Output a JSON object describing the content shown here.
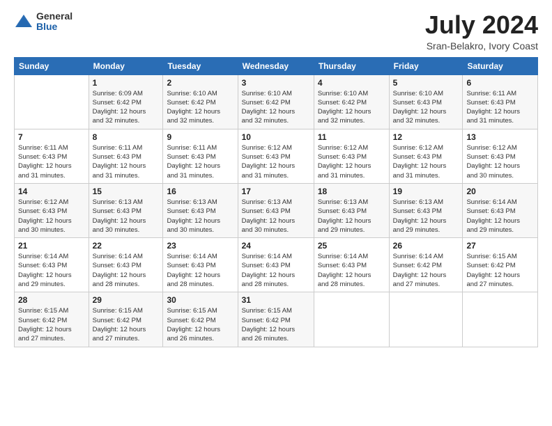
{
  "logo": {
    "general": "General",
    "blue": "Blue"
  },
  "title": {
    "month_year": "July 2024",
    "location": "Sran-Belakro, Ivory Coast"
  },
  "weekdays": [
    "Sunday",
    "Monday",
    "Tuesday",
    "Wednesday",
    "Thursday",
    "Friday",
    "Saturday"
  ],
  "weeks": [
    [
      {
        "day": "",
        "info": ""
      },
      {
        "day": "1",
        "info": "Sunrise: 6:09 AM\nSunset: 6:42 PM\nDaylight: 12 hours\nand 32 minutes."
      },
      {
        "day": "2",
        "info": "Sunrise: 6:10 AM\nSunset: 6:42 PM\nDaylight: 12 hours\nand 32 minutes."
      },
      {
        "day": "3",
        "info": "Sunrise: 6:10 AM\nSunset: 6:42 PM\nDaylight: 12 hours\nand 32 minutes."
      },
      {
        "day": "4",
        "info": "Sunrise: 6:10 AM\nSunset: 6:42 PM\nDaylight: 12 hours\nand 32 minutes."
      },
      {
        "day": "5",
        "info": "Sunrise: 6:10 AM\nSunset: 6:43 PM\nDaylight: 12 hours\nand 32 minutes."
      },
      {
        "day": "6",
        "info": "Sunrise: 6:11 AM\nSunset: 6:43 PM\nDaylight: 12 hours\nand 31 minutes."
      }
    ],
    [
      {
        "day": "7",
        "info": "Sunrise: 6:11 AM\nSunset: 6:43 PM\nDaylight: 12 hours\nand 31 minutes."
      },
      {
        "day": "8",
        "info": "Sunrise: 6:11 AM\nSunset: 6:43 PM\nDaylight: 12 hours\nand 31 minutes."
      },
      {
        "day": "9",
        "info": "Sunrise: 6:11 AM\nSunset: 6:43 PM\nDaylight: 12 hours\nand 31 minutes."
      },
      {
        "day": "10",
        "info": "Sunrise: 6:12 AM\nSunset: 6:43 PM\nDaylight: 12 hours\nand 31 minutes."
      },
      {
        "day": "11",
        "info": "Sunrise: 6:12 AM\nSunset: 6:43 PM\nDaylight: 12 hours\nand 31 minutes."
      },
      {
        "day": "12",
        "info": "Sunrise: 6:12 AM\nSunset: 6:43 PM\nDaylight: 12 hours\nand 31 minutes."
      },
      {
        "day": "13",
        "info": "Sunrise: 6:12 AM\nSunset: 6:43 PM\nDaylight: 12 hours\nand 30 minutes."
      }
    ],
    [
      {
        "day": "14",
        "info": "Sunrise: 6:12 AM\nSunset: 6:43 PM\nDaylight: 12 hours\nand 30 minutes."
      },
      {
        "day": "15",
        "info": "Sunrise: 6:13 AM\nSunset: 6:43 PM\nDaylight: 12 hours\nand 30 minutes."
      },
      {
        "day": "16",
        "info": "Sunrise: 6:13 AM\nSunset: 6:43 PM\nDaylight: 12 hours\nand 30 minutes."
      },
      {
        "day": "17",
        "info": "Sunrise: 6:13 AM\nSunset: 6:43 PM\nDaylight: 12 hours\nand 30 minutes."
      },
      {
        "day": "18",
        "info": "Sunrise: 6:13 AM\nSunset: 6:43 PM\nDaylight: 12 hours\nand 29 minutes."
      },
      {
        "day": "19",
        "info": "Sunrise: 6:13 AM\nSunset: 6:43 PM\nDaylight: 12 hours\nand 29 minutes."
      },
      {
        "day": "20",
        "info": "Sunrise: 6:14 AM\nSunset: 6:43 PM\nDaylight: 12 hours\nand 29 minutes."
      }
    ],
    [
      {
        "day": "21",
        "info": "Sunrise: 6:14 AM\nSunset: 6:43 PM\nDaylight: 12 hours\nand 29 minutes."
      },
      {
        "day": "22",
        "info": "Sunrise: 6:14 AM\nSunset: 6:43 PM\nDaylight: 12 hours\nand 28 minutes."
      },
      {
        "day": "23",
        "info": "Sunrise: 6:14 AM\nSunset: 6:43 PM\nDaylight: 12 hours\nand 28 minutes."
      },
      {
        "day": "24",
        "info": "Sunrise: 6:14 AM\nSunset: 6:43 PM\nDaylight: 12 hours\nand 28 minutes."
      },
      {
        "day": "25",
        "info": "Sunrise: 6:14 AM\nSunset: 6:43 PM\nDaylight: 12 hours\nand 28 minutes."
      },
      {
        "day": "26",
        "info": "Sunrise: 6:14 AM\nSunset: 6:42 PM\nDaylight: 12 hours\nand 27 minutes."
      },
      {
        "day": "27",
        "info": "Sunrise: 6:15 AM\nSunset: 6:42 PM\nDaylight: 12 hours\nand 27 minutes."
      }
    ],
    [
      {
        "day": "28",
        "info": "Sunrise: 6:15 AM\nSunset: 6:42 PM\nDaylight: 12 hours\nand 27 minutes."
      },
      {
        "day": "29",
        "info": "Sunrise: 6:15 AM\nSunset: 6:42 PM\nDaylight: 12 hours\nand 27 minutes."
      },
      {
        "day": "30",
        "info": "Sunrise: 6:15 AM\nSunset: 6:42 PM\nDaylight: 12 hours\nand 26 minutes."
      },
      {
        "day": "31",
        "info": "Sunrise: 6:15 AM\nSunset: 6:42 PM\nDaylight: 12 hours\nand 26 minutes."
      },
      {
        "day": "",
        "info": ""
      },
      {
        "day": "",
        "info": ""
      },
      {
        "day": "",
        "info": ""
      }
    ]
  ]
}
